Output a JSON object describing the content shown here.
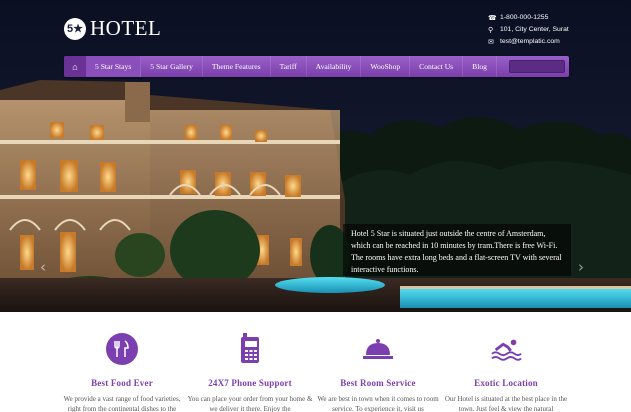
{
  "header": {
    "logo_badge": "5★",
    "logo_text": "HOTEL",
    "contact": [
      {
        "icon": "phone-icon",
        "text": "1-800-000-1255"
      },
      {
        "icon": "map-pin-icon",
        "text": "101, City Center, Surat"
      },
      {
        "icon": "mail-icon",
        "text": "test@templatic.com"
      }
    ]
  },
  "nav": {
    "items": [
      "5 Star Stays",
      "5 Star Gallery",
      "Theme Features",
      "Tariff",
      "Availability",
      "WooShop",
      "Contact Us",
      "Blog"
    ]
  },
  "slider": {
    "caption": "Hotel 5 Star is situated just outside the centre of Amsterdam, which can be reached in 10 minutes by tram.There is free Wi-Fi. The rooms have extra long beds and a flat-screen TV with several interactive functions.",
    "prev": "‹",
    "next": "›"
  },
  "features": [
    {
      "icon": "cutlery-icon",
      "title": "Best Food Ever",
      "desc": "We provide a vast range of food varieties, right from the continental dishes to the"
    },
    {
      "icon": "phone-icon",
      "title": "24X7 Phone Support",
      "desc": "You can place your order from your home & we deliver it there. Enjoy the"
    },
    {
      "icon": "room-service-icon",
      "title": "Best Room Service",
      "desc": "We are best in town when it comes to room service. To experience it, visit us"
    },
    {
      "icon": "swimming-icon",
      "title": "Exotic Location",
      "desc": "Our Hotel is situated at the best place in the town. Just feel & view the natural"
    }
  ],
  "colors": {
    "accent": "#7c3fb0",
    "nav": "#8a4fbb"
  }
}
